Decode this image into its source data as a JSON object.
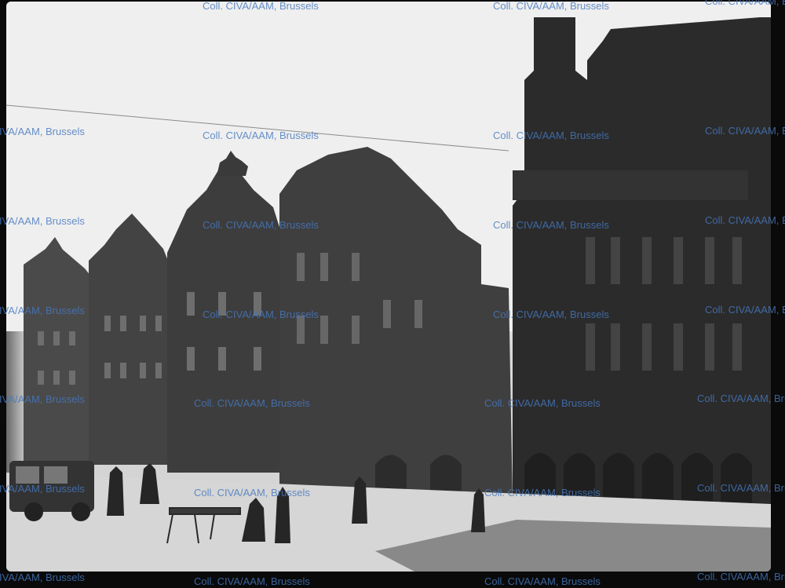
{
  "photo": {
    "subject": "Black-and-white glass-plate photograph of a city square with ornate guild houses and a gothic town hall tower",
    "watermark_text": "Coll. CIVA/AAM, Brussels",
    "colors": {
      "sky": "#efefef",
      "buildings": "#3b3b3b",
      "tower": "#2a2a2a",
      "ground": "#d8d8d8",
      "watermark": "#4678be",
      "border": "#0a0a0a"
    }
  }
}
